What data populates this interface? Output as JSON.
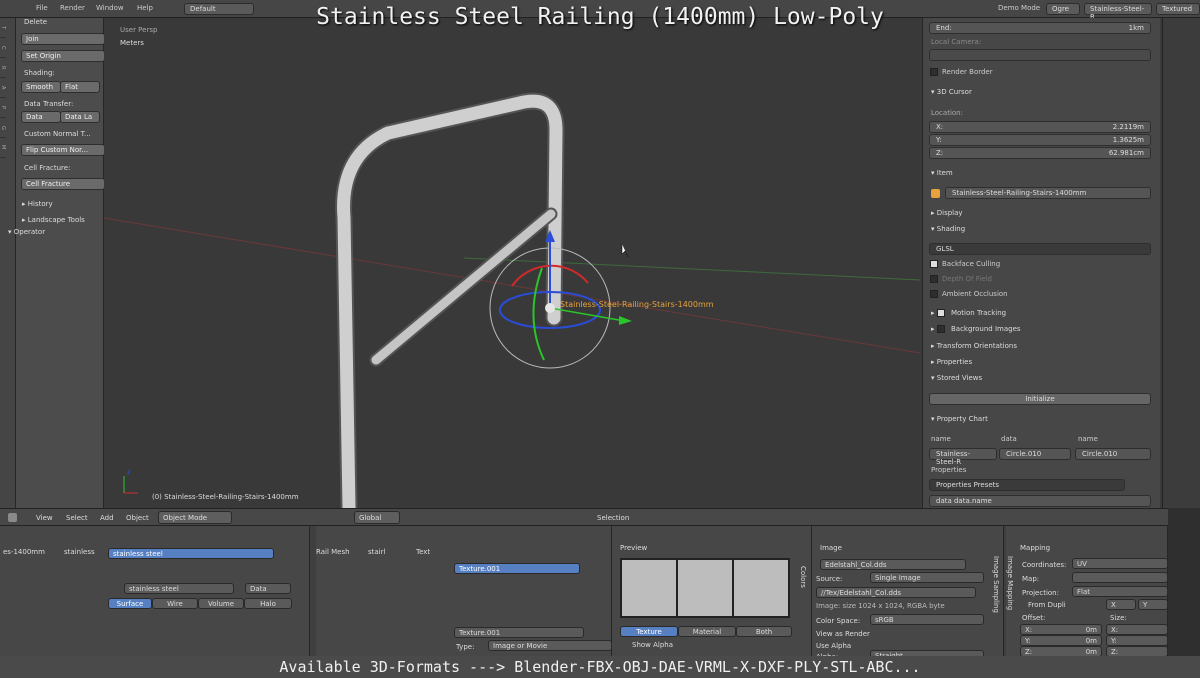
{
  "overlay": {
    "title": "Stainless Steel Railing (1400mm) Low-Poly",
    "caption": "Available 3D-Formats ---> Blender-FBX-OBJ-DAE-VRML-X-DXF-PLY-STL-ABC..."
  },
  "topbar": {
    "menus": [
      "File",
      "Render",
      "Window",
      "Help"
    ],
    "layout": "Default",
    "mode": "Demo Mode",
    "engine": "Ogre",
    "scene": "Stainless-Steel-R...",
    "shading": "Textured"
  },
  "toolshelf": {
    "delete": "Delete",
    "join": "Join",
    "set_origin": "Set Origin",
    "shading": "Shading:",
    "smooth": "Smooth",
    "flat": "Flat",
    "data_transfer": "Data Transfer:",
    "data": "Data",
    "data_la": "Data La",
    "custom_normal": "Custom Normal T...",
    "flip_custom": "Flip Custom Nor...",
    "cell_fracture_label": "Cell Fracture:",
    "cell_fracture": "Cell Fracture",
    "history": "History",
    "landscape": "Landscape Tools",
    "operator": "Operator"
  },
  "viewport": {
    "view_name": "User Persp",
    "units": "Meters",
    "object_label": "Stainless-Steel-Railing-Stairs-1400mm",
    "status": "(0) Stainless-Steel-Railing-Stairs-1400mm"
  },
  "properties": {
    "end": "End:",
    "end_value": "1km",
    "local_camera": "Local Camera:",
    "render_border": "Render Border",
    "cursor_header": "3D Cursor",
    "location": "Location:",
    "x_label": "X:",
    "x_value": "2.2119m",
    "y_label": "Y:",
    "y_value": "1.3625m",
    "z_label": "Z:",
    "z_value": "62.981cm",
    "item_header": "Item",
    "item_name": "Stainless-Steel-Railing-Stairs-1400mm",
    "display": "Display",
    "shading_header": "Shading",
    "glsl": "GLSL",
    "backface": "Backface Culling",
    "dof": "Depth Of Field",
    "ao": "Ambient Occlusion",
    "motion": "Motion Tracking",
    "background": "Background Images",
    "transform": "Transform Orientations",
    "props": "Properties",
    "stored": "Stored Views",
    "initialize": "Initialize",
    "chart": "Property Chart",
    "col_name": "name",
    "col_data": "data",
    "col_name2": "name",
    "cell1": "Stainless-Steel-R",
    "cell2": "Circle.010",
    "cell3": "Circle.010",
    "properties_label": "Properties",
    "presets": "Properties Presets",
    "data_path": "data data.name"
  },
  "viewheader": {
    "view": "View",
    "select": "Select",
    "add": "Add",
    "object": "Object",
    "mode": "Object Mode",
    "orientation": "Global",
    "selection": "Selection"
  },
  "material": {
    "obj_name": "es-1400mm",
    "mat_short": "stainless",
    "slot": "stainless steel",
    "mat_field": "stainless steel",
    "data": "Data",
    "tab_surface": "Surface",
    "tab_wire": "Wire",
    "tab_volume": "Volume",
    "tab_halo": "Halo"
  },
  "texture": {
    "mesh_label": "Rail Mesh",
    "stair": "stairl",
    "tex_label": "Text",
    "slot": "Texture.001",
    "tex_field": "Texture.001",
    "type_label": "Type:",
    "type_value": "Image or Movie"
  },
  "preview": {
    "header": "Preview",
    "tab_texture": "Texture",
    "tab_material": "Material",
    "tab_both": "Both",
    "show_alpha": "Show Alpha",
    "side_label": "Colors"
  },
  "image": {
    "header": "Image",
    "file": "Edelstahl_Col.dds",
    "source_label": "Source:",
    "source": "Single Image",
    "path": "//Tex/Edelstahl_Col.dds",
    "info": "Image: size 1024 x 1024, RGBA byte",
    "colorspace_label": "Color Space:",
    "colorspace": "sRGB",
    "view_render": "View as Render",
    "use_alpha": "Use Alpha",
    "alpha_label": "Alpha:",
    "alpha": "Straight",
    "side_label": "Image Sampling"
  },
  "mapping": {
    "header": "Mapping",
    "coords_label": "Coordinates:",
    "coords": "UV",
    "map_label": "Map:",
    "projection_label": "Projection:",
    "projection": "Flat",
    "from_dupli": "From Dupli",
    "offset": "Offset:",
    "size": "Size:",
    "ox": "X:",
    "ox_val": "0m",
    "oy": "Y:",
    "oy_val": "0m",
    "oz": "Z:",
    "oz_val": "0m",
    "sx": "X:",
    "sy": "Y:",
    "sz": "Z:",
    "x_axis": "X",
    "y_axis": "Y",
    "side_label": "Image Mapping"
  },
  "colors": {
    "selected": "#5680c2",
    "rail": "#c9c9c9",
    "grid_x": "#7a3a3a",
    "grid_y": "#3b6e3b"
  }
}
